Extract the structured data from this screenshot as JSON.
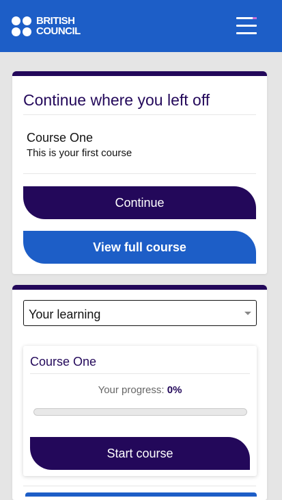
{
  "header": {
    "brand_line1": "BRITISH",
    "brand_line2": "COUNCIL",
    "background_color": "#1d5ec7",
    "menu_icon": "hamburger-menu-icon"
  },
  "continue_card": {
    "title": "Continue where you left off",
    "course_name": "Course One",
    "course_description": "This is your first course",
    "continue_label": "Continue",
    "view_full_course_label": "View full course"
  },
  "learning": {
    "select_value": "Your learning",
    "course": {
      "title": "Course One",
      "progress_label": "Your progress:",
      "progress_value": "0%",
      "progress_fraction": 0,
      "start_label": "Start course"
    }
  },
  "colors": {
    "accent_dark": "#23085a",
    "accent_blue": "#1d5ec7",
    "menu_accent": "#c86bd8"
  }
}
